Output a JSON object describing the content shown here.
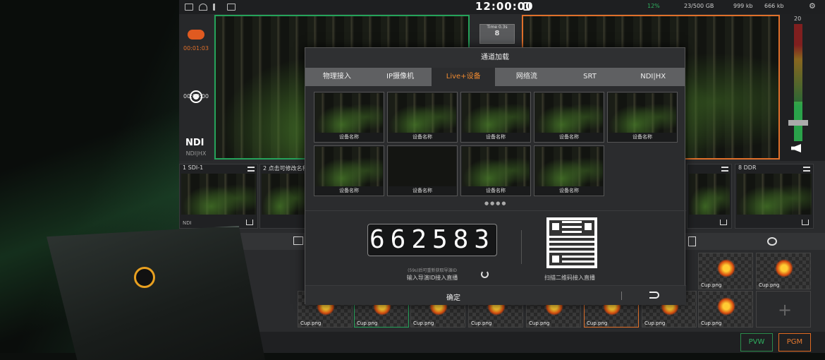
{
  "topbar": {
    "clock": "12:00:00",
    "cpu": "12%",
    "storage": "23/500 GB",
    "upload": "999 kb",
    "download": "666 kb"
  },
  "left": {
    "stream_time": "00:01:03",
    "record_time": "00:00:00",
    "ndi_label": "NDI",
    "ndi_sub": "NDI|HX"
  },
  "center": {
    "time_label": "Time 0.3s",
    "value": "8"
  },
  "meter": {
    "top_value": "20"
  },
  "tiles": [
    {
      "label": "1  SDI-1"
    },
    {
      "label": "2  点击可修改名称"
    },
    {
      "label": "8  DDR"
    }
  ],
  "tile_footer": "NDI",
  "grid": {
    "cell_label": "Cup.png"
  },
  "bottom": {
    "pvw": "PVW",
    "pgm": "PGM"
  },
  "modal": {
    "title": "通道加载",
    "tabs": [
      "物理接入",
      "IP摄像机",
      "Live+设备",
      "网络流",
      "SRT",
      "NDI|HX"
    ],
    "active_tab": 2,
    "device_name": "设备名称",
    "code": "662583",
    "hint_small": "(59s)后可重新获取导演ID",
    "hint_id": "输入导演ID接入直播",
    "hint_qr": "扫描二维码接入直播",
    "confirm": "确定"
  }
}
